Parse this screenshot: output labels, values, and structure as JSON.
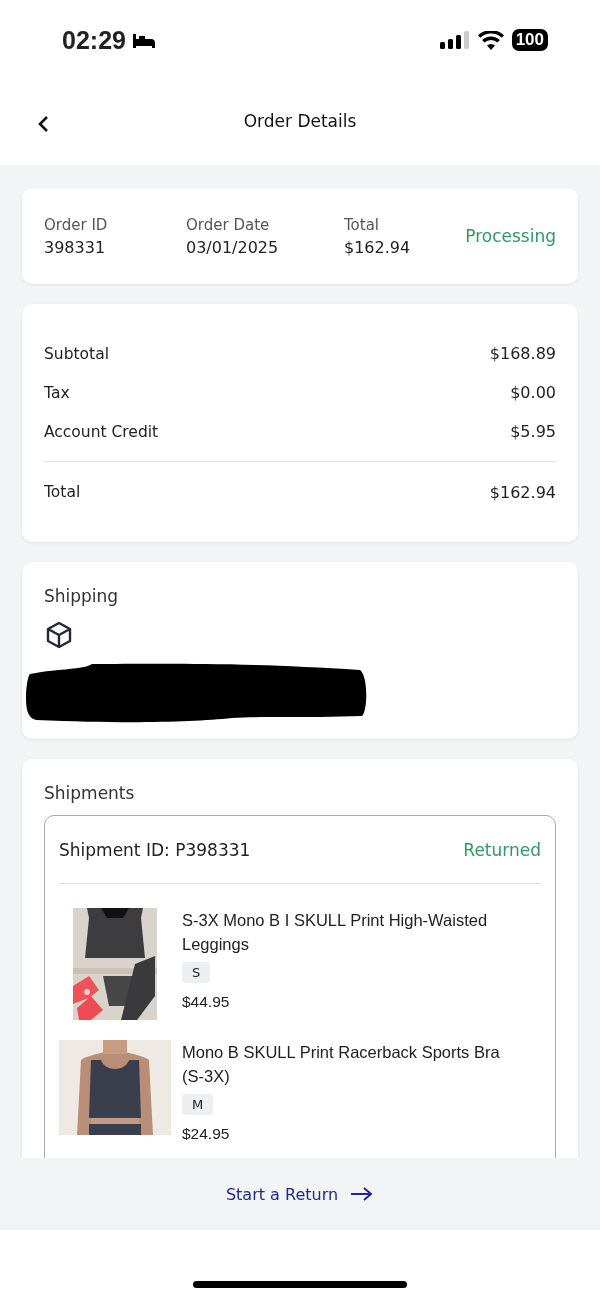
{
  "status_bar": {
    "time": "02:29",
    "battery": "100"
  },
  "header": {
    "title": "Order Details"
  },
  "order_summary": {
    "fields": [
      {
        "label": "Order ID",
        "value": "398331"
      },
      {
        "label": "Order Date",
        "value": "03/01/2025"
      },
      {
        "label": "Total",
        "value": "$162.94"
      }
    ],
    "status": "Processing"
  },
  "totals": [
    {
      "kind": "line",
      "label": "Subtotal",
      "value": "$168.89"
    },
    {
      "kind": "line",
      "label": "Tax",
      "value": "$0.00"
    },
    {
      "kind": "line",
      "label": "Account Credit",
      "value": "$5.95"
    },
    {
      "kind": "total",
      "label": "Total",
      "value": "$162.94"
    }
  ],
  "shipping": {
    "title": "Shipping",
    "redacted": true
  },
  "shipments": {
    "title": "Shipments",
    "items": [
      {
        "id": "Shipment ID: P398331",
        "status": "Returned",
        "products": [
          {
            "name": "S-3X Mono B I SKULL Print High-Waisted Leggings",
            "size": "S",
            "price": "$44.95"
          },
          {
            "name": "Mono B SKULL Print Racerback Sports Bra (S-3X)",
            "size": "M",
            "price": "$24.95"
          }
        ]
      }
    ]
  },
  "footer": {
    "action": "Start a Return"
  }
}
